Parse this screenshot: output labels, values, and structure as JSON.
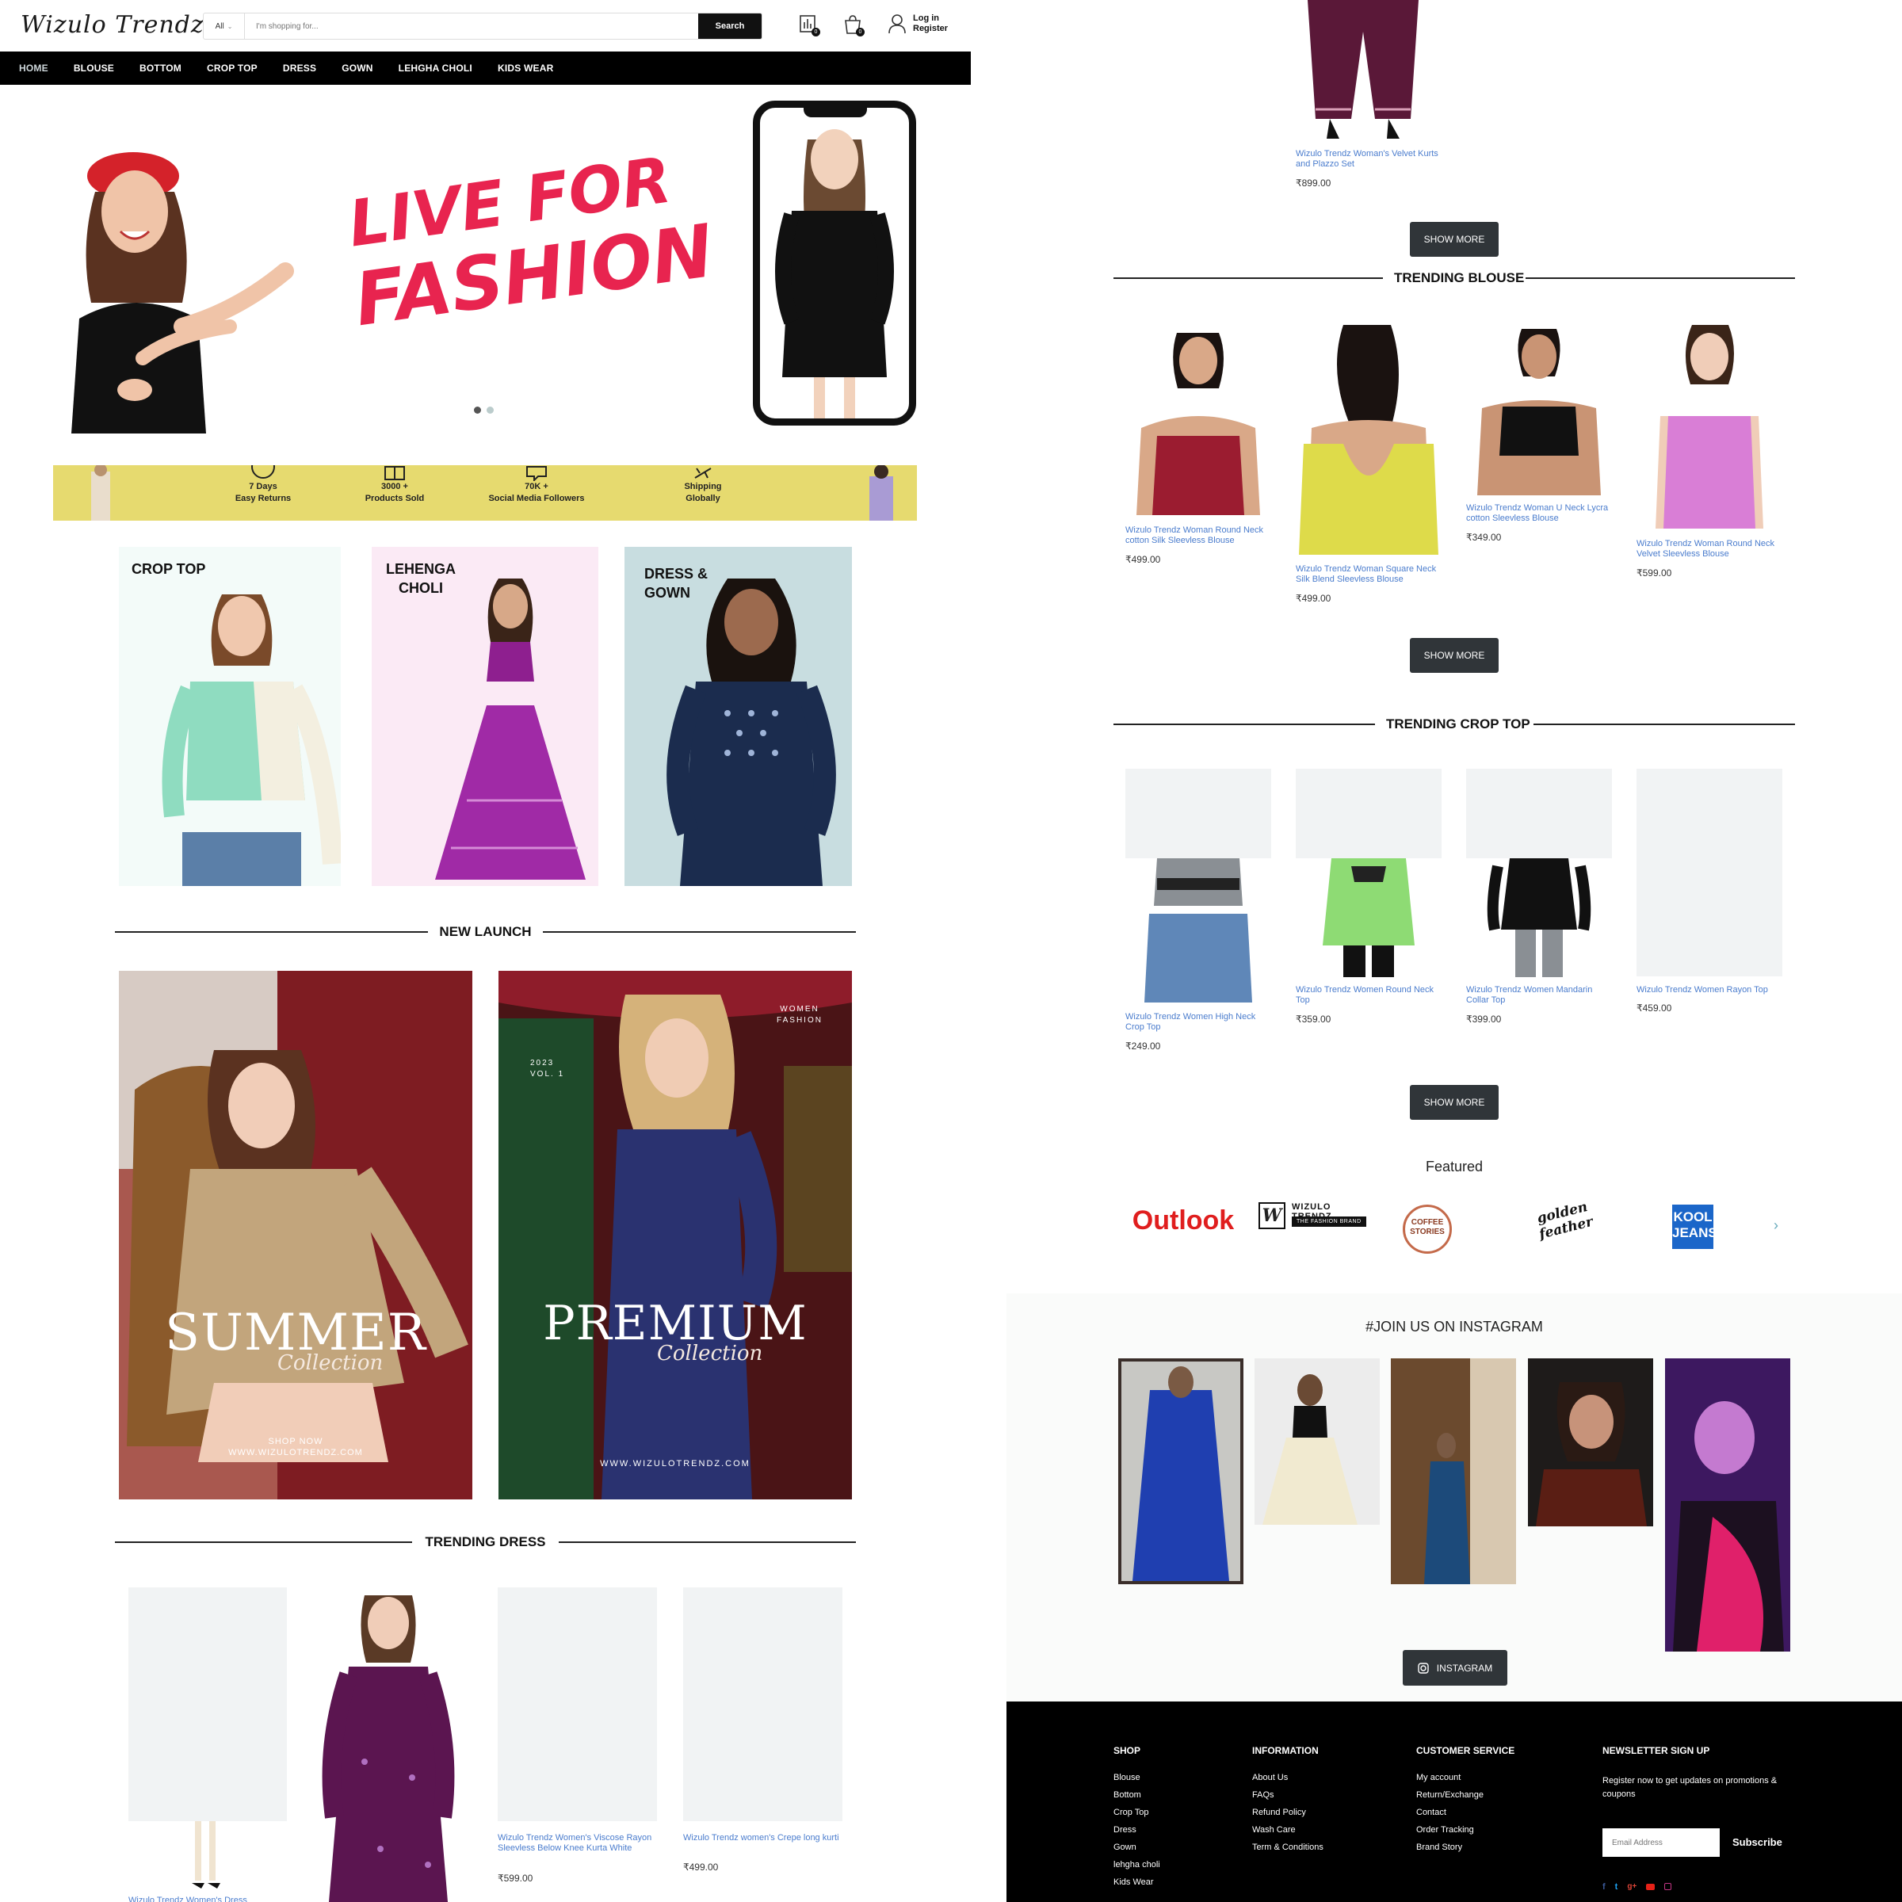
{
  "brand": {
    "logo_text": "Wizulo Trendz"
  },
  "header": {
    "search_scope": "All",
    "search_placeholder": "I'm shopping for...",
    "search_button": "Search",
    "compare_count": "0",
    "cart_count": "0",
    "login_label": "Log in",
    "register_label": "Register"
  },
  "nav": {
    "items": [
      "HOME",
      "BLOUSE",
      "BOTTOM",
      "CROP TOP",
      "DRESS",
      "GOWN",
      "LEHGHA CHOLI",
      "KIDS WEAR"
    ]
  },
  "hero": {
    "headline_line1": "LIVE FOR",
    "headline_line2": "FASHION",
    "active_slide": 1,
    "slide_count": 2
  },
  "trust_bar": {
    "items": [
      {
        "line1": "7 Days",
        "line2": "Easy Returns"
      },
      {
        "line1": "3000 +",
        "line2": "Products Sold"
      },
      {
        "line1": "70K +",
        "line2": "Social Media Followers"
      },
      {
        "line1": "Shipping",
        "line2": "Globally"
      }
    ]
  },
  "categories": [
    {
      "line1": "CROP TOP",
      "line2": ""
    },
    {
      "line1": "LEHENGA",
      "line2": "CHOLI"
    },
    {
      "line1": "DRESS &",
      "line2": "GOWN"
    }
  ],
  "new_launch": {
    "title": "NEW LAUNCH",
    "banners": [
      {
        "big": "SUMMER",
        "script": "Collection",
        "cta": "SHOP NOW",
        "site": "WWW.WIZULOTRENDZ.COM"
      },
      {
        "big": "PREMIUM",
        "script": "Collection",
        "tag1": "WOMEN",
        "tag2": "FASHION",
        "year": "2023",
        "vol": "VOL. 1",
        "site": "WWW.WIZULOTRENDZ.COM"
      }
    ]
  },
  "trending_dress": {
    "title": "TRENDING DRESS",
    "products": [
      {
        "name": "Wizulo Trendz Women's Dress",
        "price": ""
      },
      {
        "name": "",
        "price": ""
      },
      {
        "name": "Wizulo Trendz Women's Viscose Rayon Sleevless Below Knee Kurta White",
        "price": "₹599.00"
      },
      {
        "name": "Wizulo Trendz women's Crepe long kurti",
        "price": "₹499.00"
      }
    ]
  },
  "top_product": {
    "name": "Wizulo Trendz Woman's Velvet Kurts and Plazzo Set",
    "price": "₹899.00"
  },
  "show_more_label": "SHOW MORE",
  "trending_blouse": {
    "title": "TRENDING BLOUSE",
    "products": [
      {
        "name": "Wizulo Trendz Woman Round Neck cotton Silk Sleevless Blouse",
        "price": "₹499.00"
      },
      {
        "name": "Wizulo Trendz Woman Square Neck Silk Blend Sleevless Blouse",
        "price": "₹499.00"
      },
      {
        "name": "Wizulo Trendz Woman U Neck Lycra cotton Sleevless Blouse",
        "price": "₹349.00"
      },
      {
        "name": "Wizulo Trendz Woman Round Neck Velvet Sleevless Blouse",
        "price": "₹599.00"
      }
    ]
  },
  "trending_crop": {
    "title": "TRENDING CROP TOP",
    "products": [
      {
        "name": "Wizulo Trendz Women High Neck Crop Top",
        "price": "₹249.00"
      },
      {
        "name": "Wizulo Trendz Women Round Neck Top",
        "price": "₹359.00"
      },
      {
        "name": "Wizulo Trendz Women Mandarin Collar Top",
        "price": "₹399.00"
      },
      {
        "name": "Wizulo Trendz Women Rayon Top",
        "price": "₹459.00"
      }
    ]
  },
  "featured": {
    "title": "Featured",
    "logos": [
      "Outlook",
      "WIZULO TRENDZ",
      "THE FASHION BRAND",
      "COFFEE STORIES",
      "golden feather",
      "KOOL JEANS"
    ]
  },
  "instagram": {
    "title": "#JOIN US ON INSTAGRAM",
    "button": "INSTAGRAM"
  },
  "footer": {
    "shop": {
      "title": "SHOP",
      "links": [
        "Blouse",
        "Bottom",
        "Crop Top",
        "Dress",
        "Gown",
        "lehgha choli",
        "Kids Wear"
      ]
    },
    "info": {
      "title": "INFORMATION",
      "links": [
        "About Us",
        "FAQs",
        "Refund Policy",
        "Wash Care",
        "Term & Conditions"
      ]
    },
    "service": {
      "title": "CUSTOMER SERVICE",
      "links": [
        "My account",
        "Return/Exchange",
        "Contact",
        "Order Tracking",
        "Brand Story"
      ]
    },
    "newsletter": {
      "title": "NEWSLETTER SIGN UP",
      "text": "Register now to get updates on promotions & coupons",
      "placeholder": "Email Address",
      "button": "Subscribe"
    }
  },
  "colors": {
    "accent_pink": "#e8244f",
    "link_blue": "#4a7ccd",
    "dark": "#303539",
    "trust_yellow": "#e6da6f"
  }
}
